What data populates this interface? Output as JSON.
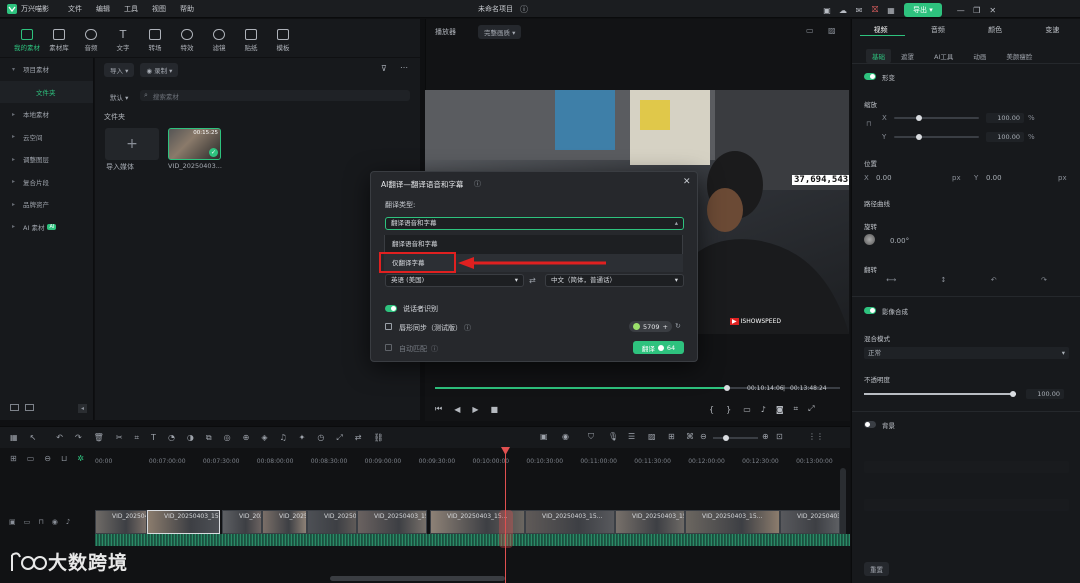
{
  "app": {
    "name": "万兴喵影",
    "project_title": "未命名项目"
  },
  "menu": [
    "文件",
    "编辑",
    "工具",
    "视图",
    "帮助"
  ],
  "titlebar": {
    "export_label": "导出"
  },
  "toolbar": [
    "我的素材",
    "素材库",
    "音频",
    "文字",
    "转场",
    "特效",
    "滤镜",
    "贴纸",
    "模板"
  ],
  "leftnav": {
    "items": [
      "项目素材",
      "文件夹",
      "本地素材",
      "云空间",
      "调整图层",
      "复合片段",
      "品牌资产",
      "AI 素材"
    ],
    "ai_badge": "AI"
  },
  "media": {
    "import_label": "导入",
    "record_label": "录制",
    "sort_label": "默认",
    "search_placeholder": "搜索素材",
    "folder_label": "文件夹",
    "import_media_label": "导入媒体",
    "clip_name": "VID_20250403...",
    "clip_duration": "00:15:25"
  },
  "player": {
    "label": "播放器",
    "quality": "完整画质",
    "time_current": "00:10:14:06",
    "time_total": "00:13:48:24",
    "progress": 0.72,
    "overlay_counter": "37,694,543",
    "watermark": "ISHOWSPEED"
  },
  "rpanel": {
    "tabs": [
      "视频",
      "音频",
      "颜色",
      "变速"
    ],
    "subtabs": [
      "基础",
      "遮罩",
      "AI工具",
      "动画",
      "美颜瘦脸"
    ],
    "shape_label": "形变",
    "scale_label": "缩放",
    "x_label": "X",
    "y_label": "Y",
    "scale_x": "100.00",
    "scale_y": "100.00",
    "percent": "%",
    "position_label": "位置",
    "pos_x": "0.00",
    "pos_y": "0.00",
    "px": "px",
    "path_curve_label": "路径曲线",
    "rotate_label": "旋转",
    "rotate_value": "0.00°",
    "flip_label": "翻转",
    "blend_label": "影像合成",
    "blend_mode_label": "混合模式",
    "blend_mode": "正常",
    "opacity_label": "不透明度",
    "opacity_value": "100.00",
    "opacity": 1.0,
    "background_label": "背景",
    "reset_label": "重置"
  },
  "timeline": {
    "ticks": [
      "00:00",
      "00:07:00:00",
      "00:07:30:00",
      "00:08:00:00",
      "00:08:30:00",
      "00:09:00:00",
      "00:09:30:00",
      "00:10:00:00",
      "00:10:30:00",
      "00:11:00:00",
      "00:11:30:00",
      "00:12:00:00",
      "00:12:30:00",
      "00:13:00:00"
    ],
    "clip_label": "VID_20250403_15..."
  },
  "dialog": {
    "title": "AI翻译—翻译语音和字幕",
    "type_label": "翻译类型:",
    "selected_type": "翻译语音和字幕",
    "options": [
      "翻译语音和字幕",
      "仅翻译字幕"
    ],
    "source_lang": "英语 (美国)",
    "target_lang": "中文（简体，普通话）",
    "speaker_label": "说话者识别",
    "lipsync_label": "唇形同步（测试版）",
    "credits": "5709",
    "auto_match_label": "自动匹配",
    "translate_label": "翻译",
    "translate_cost": "64"
  },
  "brand": {
    "watermark_text": "大数跨境"
  },
  "colors": {
    "accent": "#2ec27e",
    "highlight_red": "#e02020"
  }
}
